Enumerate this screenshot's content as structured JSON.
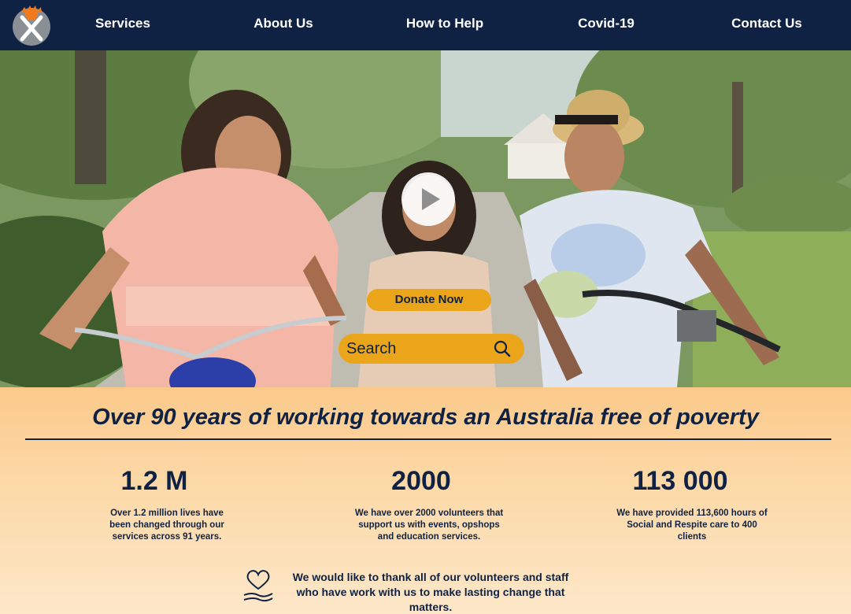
{
  "nav": {
    "logo_icon": "x-sunburst-logo-icon",
    "items": [
      {
        "label": "Services"
      },
      {
        "label": "About Us"
      },
      {
        "label": "How to Help"
      },
      {
        "label": "Covid-19"
      },
      {
        "label": "Contact Us"
      }
    ]
  },
  "hero": {
    "play_icon": "play-icon",
    "donate_label": "Donate Now",
    "search_placeholder": "Search",
    "search_icon": "search-icon"
  },
  "info": {
    "headline": "Over 90 years of working towards an Australia free of poverty",
    "stats": [
      {
        "value": "1.2 M",
        "description": "Over 1.2 million lives have been changed through our services across 91 years."
      },
      {
        "value": "2000",
        "description": "We have over 2000 volunteers that support us with events, opshops and education services."
      },
      {
        "value": "113 000",
        "description": "We have provided 113,600 hours of Social and Respite care to 400 clients"
      }
    ],
    "thanks_icon": "heart-hand-icon",
    "thanks_text": "We would like to thank all of our volunteers and staff who have work with us to make lasting change that matters."
  },
  "colors": {
    "navy": "#0f2244",
    "accent": "#eba51a",
    "peach": "#fbc98a"
  }
}
